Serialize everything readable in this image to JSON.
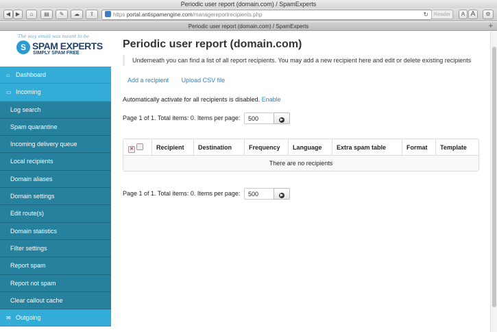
{
  "browser": {
    "window_title": "Periodic user report (domain.com) / SpamExperts",
    "tab_title": "Periodic user report (domain.com) / SpamExperts",
    "url_scheme": "https",
    "url_host": "portal.antispamengine.com",
    "url_path": "/managereportrecipients.php",
    "reader_label": "Reader",
    "font_small": "A",
    "font_large": "A",
    "new_tab": "+",
    "reload": "↻"
  },
  "brand": {
    "tagline": "The way email was meant to be",
    "name": "SPAM EXPERTS",
    "sub": "SIMPLY SPAM FREE"
  },
  "sidebar": {
    "items": [
      {
        "label": "Dashboard",
        "top": true,
        "icon": "home-icon",
        "glyph": "⌂"
      },
      {
        "label": "Incoming",
        "top": true,
        "icon": "inbox-icon",
        "glyph": "▭"
      },
      {
        "label": "Log search"
      },
      {
        "label": "Spam quarantine"
      },
      {
        "label": "Incoming delivery queue"
      },
      {
        "label": "Local recipients"
      },
      {
        "label": "Domain aliases"
      },
      {
        "label": "Domain settings"
      },
      {
        "label": "Edit route(s)"
      },
      {
        "label": "Domain statistics"
      },
      {
        "label": "Filter settings"
      },
      {
        "label": "Report spam"
      },
      {
        "label": "Report not spam"
      },
      {
        "label": "Clear callout cache"
      },
      {
        "label": "Outgoing",
        "top": true,
        "icon": "mail-icon",
        "glyph": "✉"
      }
    ]
  },
  "main": {
    "title": "Periodic user report (domain.com)",
    "intro": "Underneath you can find a list of all report recipients. You may add a new recipient here and edit or delete existing recipients",
    "add_recipient": "Add a recipient",
    "upload_csv": "Upload CSV file",
    "auto_text": "Automatically activate for all recipients is disabled.",
    "auto_link": "Enable",
    "pager_text": "Page 1 of 1. Total items: 0. Items per page:",
    "items_per_page": "500",
    "table": {
      "columns": [
        "Recipient",
        "Destination",
        "Frequency",
        "Language",
        "Extra spam table",
        "Format",
        "Template"
      ],
      "empty": "There are no recipients"
    }
  }
}
